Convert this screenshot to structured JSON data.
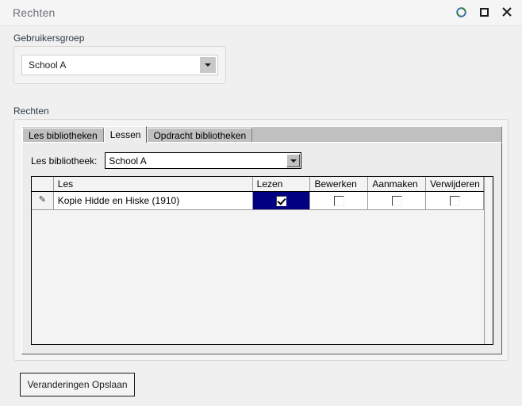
{
  "window": {
    "title": "Rechten",
    "controls": [
      {
        "name": "refresh-icon",
        "label": "Vernieuwen"
      },
      {
        "name": "maximize-icon",
        "label": "Maximaliseren"
      },
      {
        "name": "close-icon",
        "label": "Sluiten"
      }
    ]
  },
  "usergroup": {
    "label": "Gebruikersgroep",
    "combo_value": "School A"
  },
  "rechten": {
    "label": "Rechten",
    "tabs": [
      {
        "label": "Les bibliotheken",
        "active": false
      },
      {
        "label": "Lessen",
        "active": true
      },
      {
        "label": "Opdracht bibliotheken",
        "active": false
      }
    ],
    "les_bibliotheek": {
      "label": "Les bibliotheek:",
      "combo_value": "School A"
    },
    "grid": {
      "columns": [
        "",
        "Les",
        "Lezen",
        "Bewerken",
        "Aanmaken",
        "Verwijderen"
      ],
      "rows": [
        {
          "indicator": "edit-pencil",
          "les": "Kopie Hidde en Hiske (1910)",
          "lezen": true,
          "bewerken": false,
          "aanmaken": false,
          "verwijderen": false,
          "selected_cell": "lezen"
        }
      ]
    }
  },
  "footer": {
    "save_label": "Veranderingen Opslaan"
  },
  "colors": {
    "selection": "#000080",
    "titlebar_text": "#6f6f76",
    "window_bg": "#f0f0f0",
    "panel_bg": "#f4f4f4"
  }
}
